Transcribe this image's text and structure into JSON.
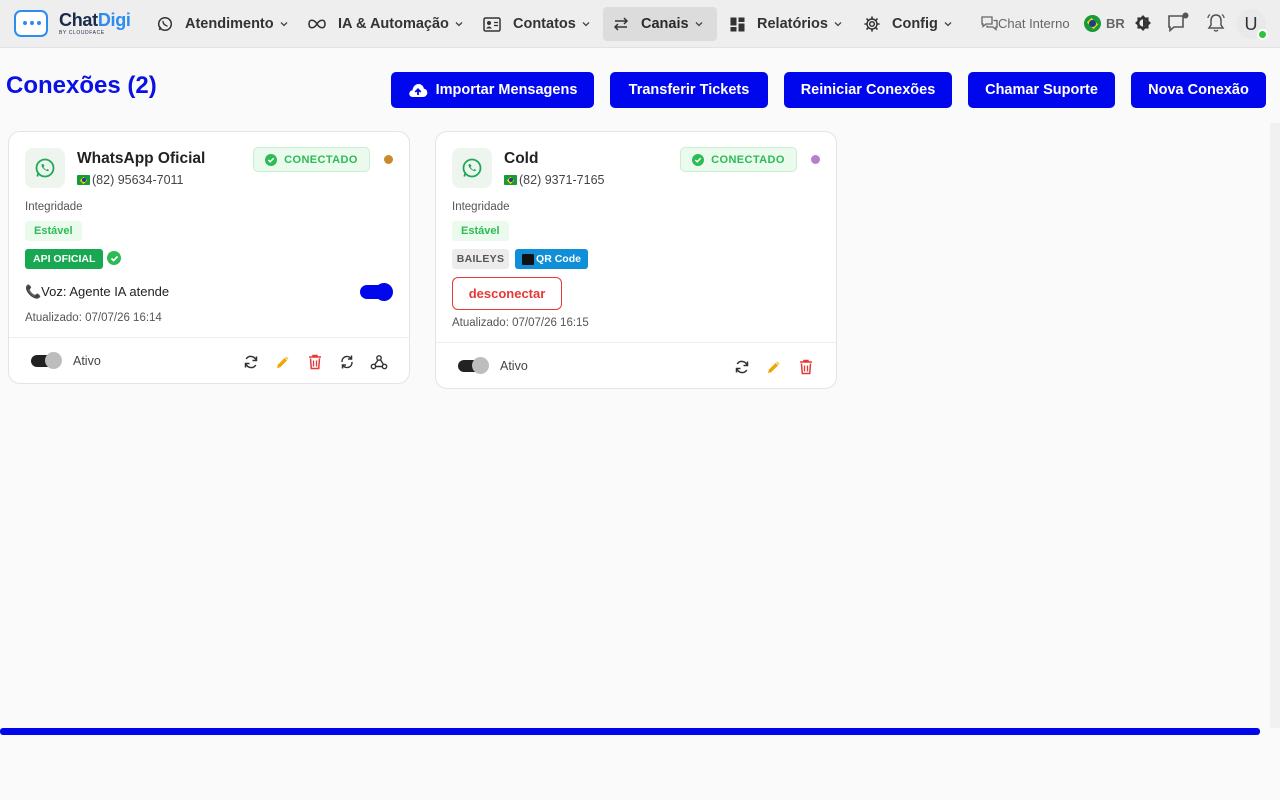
{
  "app": {
    "brand_part1": "Chat",
    "brand_part2": "Digi",
    "brand_sub": "BY CLOUDFACE"
  },
  "nav": [
    {
      "label": "Atendimento",
      "icon": "whatsapp-icon"
    },
    {
      "label": "IA & Automação",
      "icon": "infinity-icon"
    },
    {
      "label": "Contatos",
      "icon": "contact-card-icon"
    },
    {
      "label": "Canais",
      "icon": "swap-arrows-icon",
      "active": true
    },
    {
      "label": "Relatórios",
      "icon": "dashboard-icon"
    },
    {
      "label": "Config",
      "icon": "gear-icon"
    }
  ],
  "topright": {
    "chat_interno": "Chat Interno",
    "language": "BR",
    "avatar_initial": "U"
  },
  "page": {
    "title": "Conexões (2)"
  },
  "actions": {
    "importar": "Importar Mensagens",
    "transferir": "Transferir Tickets",
    "reiniciar": "Reiniciar Conexões",
    "suporte": "Chamar Suporte",
    "nova": "Nova Conexão"
  },
  "connections": [
    {
      "name": "WhatsApp Oficial",
      "phone": "(82) 95634-7011",
      "status": "CONECTADO",
      "dot_color": "#c98a2e",
      "integrity_label": "Integridade",
      "integrity_value": "Estável",
      "type_tag": "API OFICIAL",
      "voice_label": "📞Voz: Agente IA atende",
      "voice_enabled": true,
      "updated": "Atualizado: 07/07/26 16:14",
      "active_label": "Ativo"
    },
    {
      "name": "Cold",
      "phone": "(82) 9371-7165",
      "status": "CONECTADO",
      "dot_color": "#b57fd0",
      "integrity_label": "Integridade",
      "integrity_value": "Estável",
      "type_tag": "BAILEYS",
      "qr_tag": "QR Code",
      "disconnect_label": "desconectar",
      "updated": "Atualizado: 07/07/26 16:15",
      "active_label": "Ativo"
    }
  ],
  "colors": {
    "primary": "#0007ec",
    "success": "#2cbb55",
    "danger": "#e53935",
    "edit": "#f0a500"
  }
}
